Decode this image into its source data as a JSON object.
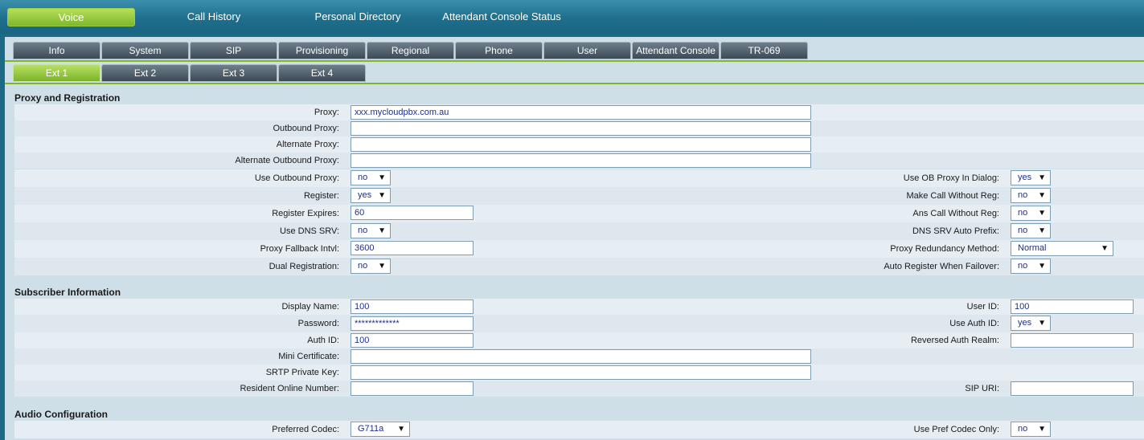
{
  "topnav": {
    "items": [
      "Voice",
      "Call History",
      "Personal Directory",
      "Attendant Console Status"
    ]
  },
  "tabs": {
    "main": [
      "Info",
      "System",
      "SIP",
      "Provisioning",
      "Regional",
      "Phone",
      "User",
      "Attendant Console",
      "TR-069"
    ],
    "ext": [
      "Ext 1",
      "Ext 2",
      "Ext 3",
      "Ext 4"
    ]
  },
  "sections": {
    "proxy": "Proxy and Registration",
    "subscriber": "Subscriber Information",
    "audio": "Audio Configuration"
  },
  "proxy": {
    "proxy_label": "Proxy:",
    "proxy_value": "xxx.mycloudpbx.com.au",
    "outbound_label": "Outbound Proxy:",
    "outbound_value": "",
    "alt_label": "Alternate Proxy:",
    "alt_value": "",
    "alt_out_label": "Alternate Outbound Proxy:",
    "alt_out_value": "",
    "use_ob_label": "Use Outbound Proxy:",
    "use_ob_value": "no",
    "use_ob_dialog_label": "Use OB Proxy In Dialog:",
    "use_ob_dialog_value": "yes",
    "register_label": "Register:",
    "register_value": "yes",
    "make_call_label": "Make Call Without Reg:",
    "make_call_value": "no",
    "reg_expires_label": "Register Expires:",
    "reg_expires_value": "60",
    "ans_call_label": "Ans Call Without Reg:",
    "ans_call_value": "no",
    "dns_srv_label": "Use DNS SRV:",
    "dns_srv_value": "no",
    "dns_prefix_label": "DNS SRV Auto Prefix:",
    "dns_prefix_value": "no",
    "fallback_label": "Proxy Fallback Intvl:",
    "fallback_value": "3600",
    "redundancy_label": "Proxy Redundancy Method:",
    "redundancy_value": "Normal",
    "dual_label": "Dual Registration:",
    "dual_value": "no",
    "auto_reg_label": "Auto Register When Failover:",
    "auto_reg_value": "no"
  },
  "subscriber": {
    "display_label": "Display Name:",
    "display_value": "100",
    "userid_label": "User ID:",
    "userid_value": "100",
    "password_label": "Password:",
    "password_value": "*************",
    "useauth_label": "Use Auth ID:",
    "useauth_value": "yes",
    "authid_label": "Auth ID:",
    "authid_value": "100",
    "realm_label": "Reversed Auth Realm:",
    "realm_value": "",
    "cert_label": "Mini Certificate:",
    "cert_value": "",
    "srtp_label": "SRTP Private Key:",
    "srtp_value": "",
    "resident_label": "Resident Online Number:",
    "resident_value": "",
    "sipuri_label": "SIP URI:",
    "sipuri_value": ""
  },
  "audio": {
    "codec_label": "Preferred Codec:",
    "codec_value": "G711a",
    "pref_only_label": "Use Pref Codec Only:",
    "pref_only_value": "no"
  }
}
